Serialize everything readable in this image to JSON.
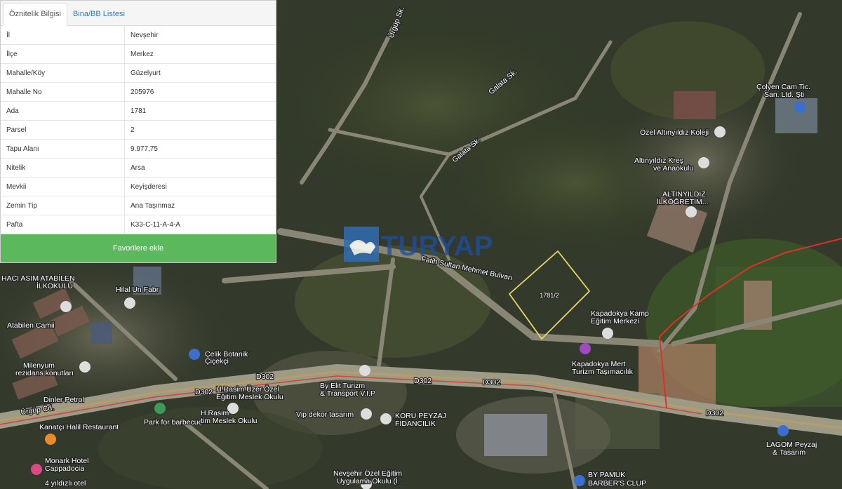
{
  "tabs": [
    {
      "label": "Öznitelik Bilgisi",
      "active": true
    },
    {
      "label": "Bina/BB Listesi",
      "active": false
    }
  ],
  "attributes": [
    {
      "key": "İl",
      "value": "Nevşehir"
    },
    {
      "key": "İlçe",
      "value": "Merkez"
    },
    {
      "key": "Mahalle/Köy",
      "value": "Güzelyurt"
    },
    {
      "key": "Mahalle No",
      "value": "205976"
    },
    {
      "key": "Ada",
      "value": "1781"
    },
    {
      "key": "Parsel",
      "value": "2"
    },
    {
      "key": "Tapu Alanı",
      "value": "9.977,75"
    },
    {
      "key": "Nitelik",
      "value": "Arsa"
    },
    {
      "key": "Mevkii",
      "value": "Keyişderesi"
    },
    {
      "key": "Zemin Tip",
      "value": "Ana Taşınmaz"
    },
    {
      "key": "Pafta",
      "value": "K33-C-11-A-4-A"
    }
  ],
  "favorite_button": "Favorilere ekle",
  "watermark": "TURYAP",
  "parcel_label": "1781/2",
  "colors": {
    "parcel_outline": "#e8d468",
    "button": "#5cb85c",
    "tab_link": "#337ab7",
    "boundary": "#d9322a"
  },
  "map_labels": {
    "hacasim": "HACI ASIM ATABİLEN",
    "ilkokulu": "İLKOKULU",
    "hilalun": "Hilal Un Fabr",
    "atabilen": "Atabilen Camii",
    "milenyum": "Milenyum",
    "rezidans": "rezidans konutları",
    "celik": "Çelik Botanik",
    "cicekci": "Çiçekçi",
    "hrasim": "H.Rasim Üzer Özel",
    "egitim": "Eğitim Meslek Okulu",
    "bytur": "By Elit Turizm",
    "transport": "& Transport V.I.P",
    "dinler": "Dinler Petrol",
    "urgup": "Ürgüp Cd.",
    "park": "Park for barbecue",
    "hrasim2": "H.Rasim",
    "tim": "tim Meslek Okulu",
    "kanatci": "Kanatçı Halil Restaurant",
    "vip": "Vip dekor tasarım",
    "koru": "KORU PEYZAJ",
    "fidan": "FİDANCILIK",
    "monark": "Monark Hotel",
    "cappadocia": "Cappadocia",
    "yildiz": "4 yıldızlı otel",
    "nevsehir_ozel": "Nevşehir Özel Eğitim",
    "uygulama": "Uygulama Okulu (İ...",
    "bypamuk": "BY PAMUK",
    "barbers": "BARBER'S CLUP",
    "lagom": "LAGOM Peyzaj",
    "tasarim": "& Tasarım",
    "kapkamp": "Kapadokya Kamp",
    "egitimmerkez": "Eğitim Merkezi",
    "kapmert": "Kapadokya Mert",
    "turizm": "Turizm Taşımacılık",
    "altinyildiz": "Özel Altınyıldız Koleji",
    "altinkres": "Altınyıldız Kreş",
    "anaokulu": "ve Anaokulu",
    "altinyildiz2": "ALTINYILDIZ",
    "ilkogretim": "İLKÖĞRETİM...",
    "colyen": "Çolyen Cam Tic.",
    "san": "San. Ltd. Şti",
    "urgupsk": "Ürgüp Sk.",
    "galatask": "Galata Sk.",
    "galatask2": "Galata Sk.",
    "d302a": "D302",
    "d302b": "D302",
    "d302c": "D302",
    "d302d": "D302",
    "d302e": "D302",
    "fatih": "Fatih Sultan Mehmet Bulvarı"
  }
}
